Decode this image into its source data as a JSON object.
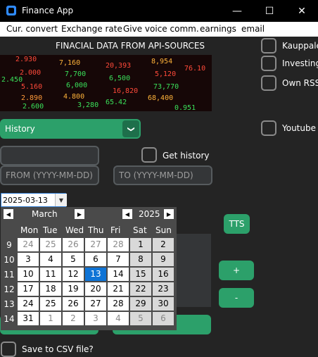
{
  "window": {
    "title": "Finance App",
    "min_glyph": "—",
    "max_glyph": "☐",
    "close_glyph": "✕"
  },
  "menu": [
    "Cur. convert",
    "Exchange rate",
    "Give voice comm.",
    "earnings",
    "email"
  ],
  "section_title": "FINACIAL DATA FROM API-SOURCES",
  "banner_numbers": [
    "2.930",
    "2.000",
    "5.160",
    "2.890",
    "2.600",
    "2.450",
    "7,160",
    "7,700",
    "6,000",
    "4.800",
    "3,280",
    "20,393",
    "6,500",
    "16,820",
    "65.42",
    "8,954",
    "5,120",
    "73,770",
    "68,400",
    "76.10",
    "0.951"
  ],
  "right_options": [
    "Kauppalehti",
    "Investing",
    "Own RSS",
    "Youtube"
  ],
  "source_select": {
    "value": "History",
    "arrow": "❯"
  },
  "ticker_input": {
    "value": "",
    "placeholder": ""
  },
  "get_history_label": "Get history",
  "from_input": {
    "placeholder": "FROM (YYYY-MM-DD)"
  },
  "to_input": {
    "placeholder": "TO (YYYY-MM-DD)"
  },
  "date_entry": {
    "value": "2025-03-13"
  },
  "tts_label": "TTS",
  "plus_label": "+",
  "minus_label": "-",
  "save_csv_label": "Save to CSV file?",
  "calendar": {
    "month": "March",
    "year": "2025",
    "weekdays": [
      "Mon",
      "Tue",
      "Wed",
      "Thu",
      "Fri",
      "Sat",
      "Sun"
    ],
    "weeks": [
      {
        "num": "9",
        "days": [
          {
            "d": "24",
            "o": 1
          },
          {
            "d": "25",
            "o": 1
          },
          {
            "d": "26",
            "o": 1
          },
          {
            "d": "27",
            "o": 1
          },
          {
            "d": "28",
            "o": 1
          },
          {
            "d": "1",
            "o": 0
          },
          {
            "d": "2",
            "o": 0
          }
        ]
      },
      {
        "num": "10",
        "days": [
          {
            "d": "3",
            "o": 0
          },
          {
            "d": "4",
            "o": 0
          },
          {
            "d": "5",
            "o": 0
          },
          {
            "d": "6",
            "o": 0
          },
          {
            "d": "7",
            "o": 0
          },
          {
            "d": "8",
            "o": 0
          },
          {
            "d": "9",
            "o": 0
          }
        ]
      },
      {
        "num": "11",
        "days": [
          {
            "d": "10",
            "o": 0
          },
          {
            "d": "11",
            "o": 0
          },
          {
            "d": "12",
            "o": 0
          },
          {
            "d": "13",
            "o": 0
          },
          {
            "d": "14",
            "o": 0
          },
          {
            "d": "15",
            "o": 0
          },
          {
            "d": "16",
            "o": 0
          }
        ]
      },
      {
        "num": "12",
        "days": [
          {
            "d": "17",
            "o": 0
          },
          {
            "d": "18",
            "o": 0
          },
          {
            "d": "19",
            "o": 0
          },
          {
            "d": "20",
            "o": 0
          },
          {
            "d": "21",
            "o": 0
          },
          {
            "d": "22",
            "o": 0
          },
          {
            "d": "23",
            "o": 0
          }
        ]
      },
      {
        "num": "13",
        "days": [
          {
            "d": "24",
            "o": 0
          },
          {
            "d": "25",
            "o": 0
          },
          {
            "d": "26",
            "o": 0
          },
          {
            "d": "27",
            "o": 0
          },
          {
            "d": "28",
            "o": 0
          },
          {
            "d": "29",
            "o": 0
          },
          {
            "d": "30",
            "o": 0
          }
        ]
      },
      {
        "num": "14",
        "days": [
          {
            "d": "31",
            "o": 0
          },
          {
            "d": "1",
            "o": 1
          },
          {
            "d": "2",
            "o": 1
          },
          {
            "d": "3",
            "o": 1
          },
          {
            "d": "4",
            "o": 1
          },
          {
            "d": "5",
            "o": 1
          },
          {
            "d": "6",
            "o": 1
          }
        ]
      }
    ],
    "selected_day": "13"
  },
  "colors": {
    "accent_green": "#2ca06a",
    "selected_blue": "#0f74d6",
    "background": "#242424"
  }
}
